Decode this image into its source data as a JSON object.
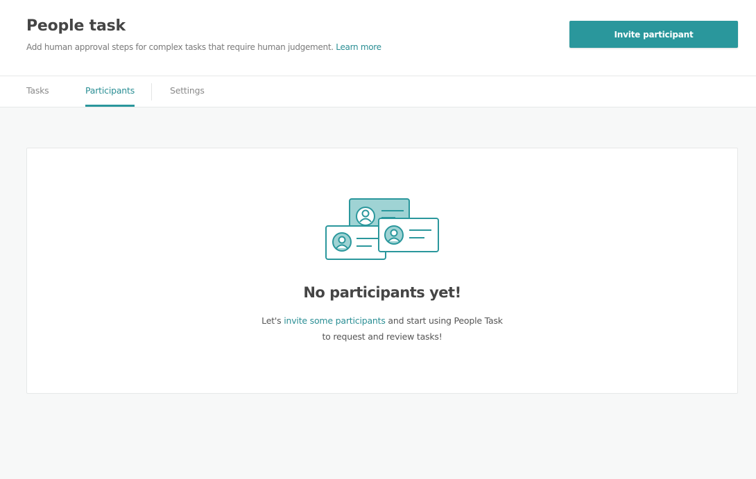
{
  "header": {
    "title": "People task",
    "subtitle": "Add human approval steps for complex tasks that require human judgement.",
    "learn_more": "Learn more",
    "invite_button": "Invite participant"
  },
  "tabs": [
    {
      "label": "Tasks",
      "active": false
    },
    {
      "label": "Participants",
      "active": true
    },
    {
      "label": "Settings",
      "active": false
    }
  ],
  "empty_state": {
    "title": "No participants yet!",
    "text_before": "Let's ",
    "link": "invite some participants",
    "text_after": " and start using People Task to request and review tasks!"
  },
  "colors": {
    "accent": "#2a979c",
    "link": "#2a8e94",
    "illustration_fill": "#9fd3d4"
  },
  "icons": [
    "participant-cards-illustration"
  ]
}
